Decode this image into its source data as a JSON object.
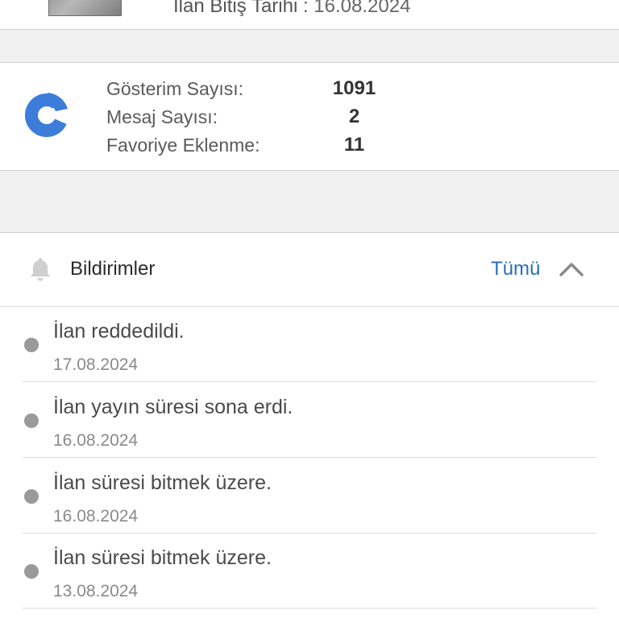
{
  "listing": {
    "end_date_label": "İlan Bitiş Tarihi :",
    "end_date_value": "16.08.2024"
  },
  "stats": {
    "icon": "donut-chart-icon",
    "accent_color": "#3b7dd8",
    "rows": [
      {
        "label": "Gösterim Sayısı:",
        "value": "1091"
      },
      {
        "label": "Mesaj Sayısı:",
        "value": "2"
      },
      {
        "label": "Favoriye Eklenme:",
        "value": "11"
      }
    ]
  },
  "notifications": {
    "icon": "bell-icon",
    "title": "Bildirimler",
    "see_all_label": "Tümü",
    "toggle_icon": "chevron-up-icon",
    "link_color": "#2a6eb5",
    "items": [
      {
        "text": "İlan reddedildi.",
        "date": "17.08.2024"
      },
      {
        "text": "İlan yayın süresi sona erdi.",
        "date": "16.08.2024"
      },
      {
        "text": "İlan süresi bitmek üzere.",
        "date": "16.08.2024"
      },
      {
        "text": "İlan süresi bitmek üzere.",
        "date": "13.08.2024"
      }
    ]
  }
}
